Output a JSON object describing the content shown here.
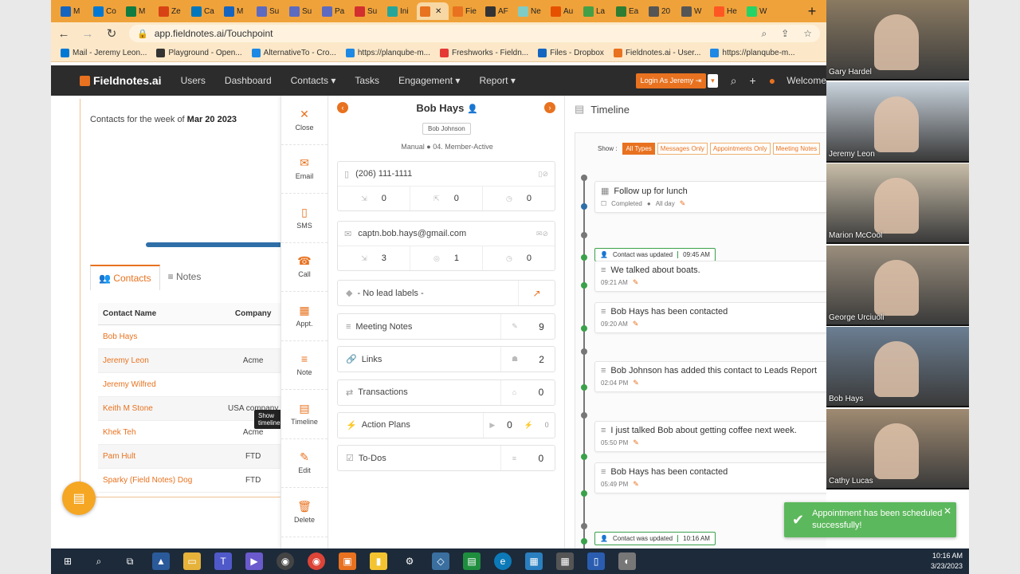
{
  "browser": {
    "tabs": [
      {
        "label": "M",
        "color": "#1565c0"
      },
      {
        "label": "Co",
        "color": "#0078d4"
      },
      {
        "label": "M",
        "color": "#107c41"
      },
      {
        "label": "Ze",
        "color": "#d84315"
      },
      {
        "label": "Ca",
        "color": "#0277bd"
      },
      {
        "label": "M",
        "color": "#1565c0"
      },
      {
        "label": "Su",
        "color": "#5c6bc0"
      },
      {
        "label": "Su",
        "color": "#5c6bc0"
      },
      {
        "label": "Pa",
        "color": "#5c6bc0"
      },
      {
        "label": "Su",
        "color": "#d32f2f"
      },
      {
        "label": "Ini",
        "color": "#26a69a"
      },
      {
        "label": "",
        "color": "#e8721f",
        "active": true
      },
      {
        "label": "Fie",
        "color": "#e8721f"
      },
      {
        "label": "AF",
        "color": "#333333"
      },
      {
        "label": "Ne",
        "color": "#80cbc4"
      },
      {
        "label": "Au",
        "color": "#e65100"
      },
      {
        "label": "La",
        "color": "#43a047"
      },
      {
        "label": "Ea",
        "color": "#2e7d32"
      },
      {
        "label": "20",
        "color": "#555555"
      },
      {
        "label": "W",
        "color": "#555555"
      },
      {
        "label": "He",
        "color": "#ff5722"
      },
      {
        "label": "W",
        "color": "#25d366"
      }
    ],
    "active_tab_close": "✕",
    "new_tab": "+",
    "url": "app.fieldnotes.ai/Touchpoint",
    "bookmarks": [
      {
        "label": "Mail - Jeremy Leon...",
        "color": "#0078d4"
      },
      {
        "label": "Playground - Open...",
        "color": "#333333"
      },
      {
        "label": "AlternativeTo - Cro...",
        "color": "#1e88e5"
      },
      {
        "label": "https://planqube-m...",
        "color": "#1e88e5"
      },
      {
        "label": "Freshworks - Fieldn...",
        "color": "#e53935"
      },
      {
        "label": "Files - Dropbox",
        "color": "#1565c0"
      },
      {
        "label": "Fieldnotes.ai - User...",
        "color": "#e8721f"
      },
      {
        "label": "https://planqube-m...",
        "color": "#1e88e5"
      }
    ]
  },
  "app": {
    "logo": "Fieldnotes.ai",
    "menu": [
      "Users",
      "Dashboard",
      "Contacts ▾",
      "Tasks",
      "Engagement ▾",
      "Report ▾"
    ],
    "login_as": "Login As Jeremy ⇥",
    "login_dd": "▾",
    "welcome": "Welcome"
  },
  "left": {
    "week_prefix": "Contacts for the week of ",
    "week_date": "Mar 20 2023",
    "tab_contacts": "Contacts",
    "tab_notes": "Notes",
    "table_headers": [
      "Contact Name",
      "Company"
    ],
    "rows": [
      {
        "name": "Bob Hays",
        "company": ""
      },
      {
        "name": "Jeremy Leon",
        "company": "Acme"
      },
      {
        "name": "Jeremy Wilfred",
        "company": ""
      },
      {
        "name": "Keith M Stone",
        "company": "USA company"
      },
      {
        "name": "Khek Teh",
        "company": "Acme"
      },
      {
        "name": "Pam Hult",
        "company": "FTD"
      },
      {
        "name": "Sparky (Field Notes) Dog",
        "company": "FTD"
      }
    ],
    "tooltip": "Show timeline"
  },
  "actions": [
    {
      "name": "close",
      "label": "Close",
      "icon": "✕"
    },
    {
      "name": "email",
      "label": "Email",
      "icon": "✉"
    },
    {
      "name": "sms",
      "label": "SMS",
      "icon": "▯"
    },
    {
      "name": "call",
      "label": "Call",
      "icon": "☎"
    },
    {
      "name": "appt",
      "label": "Appt.",
      "icon": "▦"
    },
    {
      "name": "note",
      "label": "Note",
      "icon": "≡"
    },
    {
      "name": "timeline",
      "label": "Timeline",
      "icon": "▤"
    },
    {
      "name": "edit",
      "label": "Edit",
      "icon": "✎"
    },
    {
      "name": "delete",
      "label": "Delete",
      "icon": "🗑"
    }
  ],
  "contact": {
    "name": "Bob Hays",
    "owner": "Bob Johnson",
    "source": "Manual",
    "status": "04. Member-Active",
    "phone": "(206) 111-1111",
    "phone_counts": [
      "0",
      "0",
      "0"
    ],
    "email": "captn.bob.hays@gmail.com",
    "email_counts": [
      "3",
      "1",
      "0"
    ],
    "lead_labels": "- No lead labels -",
    "sections": [
      {
        "name": "meeting-notes",
        "label": "Meeting Notes",
        "count": "9"
      },
      {
        "name": "links",
        "label": "Links",
        "count": "2"
      },
      {
        "name": "transactions",
        "label": "Transactions",
        "count": "0"
      },
      {
        "name": "action-plans",
        "label": "Action Plans",
        "count": "0",
        "count2": "0"
      },
      {
        "name": "todos",
        "label": "To-Dos",
        "count": "0"
      }
    ]
  },
  "timeline": {
    "title": "Timeline",
    "show_label": "Show :",
    "filters": [
      "All Types",
      "Messages Only",
      "Appointments Only",
      "Meeting Notes"
    ],
    "items": [
      {
        "kind": "card",
        "title": "Follow up for lunch",
        "meta1": "Completed",
        "meta2": "All day",
        "icon": "▦"
      },
      {
        "kind": "chip",
        "title": "Contact was updated",
        "time": "09:45 AM"
      },
      {
        "kind": "card",
        "title": "We talked about boats.",
        "meta1": "09:21 AM",
        "icon": "≡"
      },
      {
        "kind": "card",
        "title": "Bob Hays has been contacted",
        "meta1": "09:20 AM",
        "icon": "≡"
      },
      {
        "kind": "card",
        "title": "Bob Johnson has added this contact to Leads Report",
        "meta1": "02:04 PM",
        "icon": "≡"
      },
      {
        "kind": "card",
        "title": "I just talked Bob about getting coffee next week.",
        "meta1": "05:50 PM",
        "icon": "≡"
      },
      {
        "kind": "card",
        "title": "Bob Hays has been contacted",
        "meta1": "05:49 PM",
        "icon": "≡"
      },
      {
        "kind": "chip",
        "title": "Contact was updated",
        "time": "10:16 AM"
      }
    ]
  },
  "toast": {
    "message": "Appointment has been scheduled successfully!",
    "close": "✕"
  },
  "participants": [
    {
      "name": "Gary Hardel",
      "bg": "#8a7a62"
    },
    {
      "name": "Jeremy Leon",
      "bg": "#c9d3dc"
    },
    {
      "name": "Marion McCool",
      "bg": "#c8bda8"
    },
    {
      "name": "George Urciuoli",
      "bg": "#9a8e7d"
    },
    {
      "name": "Bob Hays",
      "bg": "#6b7e92"
    },
    {
      "name": "Cathy Lucas",
      "bg": "#a08b72"
    }
  ],
  "clock": {
    "time": "10:16 AM",
    "date": "3/23/2023"
  }
}
